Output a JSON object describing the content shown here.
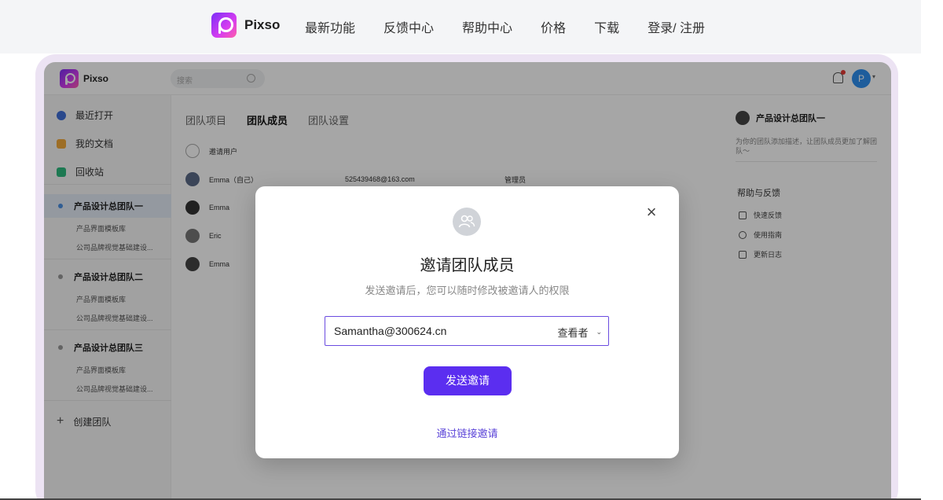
{
  "site": {
    "brand": "Pixso",
    "links": [
      "最新功能",
      "反馈中心",
      "帮助中心",
      "价格",
      "下载",
      "登录/ 注册"
    ]
  },
  "app": {
    "brand": "Pixso",
    "search_placeholder": "搜索",
    "avatar_letter": "P",
    "sidebar": {
      "recent": "最近打开",
      "docs": "我的文档",
      "trash": "回收站",
      "teams": [
        {
          "name": "产品设计总团队一",
          "subs": [
            "产品界面模板库",
            "公司品牌视觉基础建设..."
          ]
        },
        {
          "name": "产品设计总团队二",
          "subs": [
            "产品界面模板库",
            "公司品牌视觉基础建设..."
          ]
        },
        {
          "name": "产品设计总团队三",
          "subs": [
            "产品界面模板库",
            "公司品牌视觉基础建设..."
          ]
        }
      ],
      "create_team": "创建团队"
    },
    "tabs": [
      "团队项目",
      "团队成员",
      "团队设置"
    ],
    "members": [
      {
        "name": "邀请用户"
      },
      {
        "name": "Emma（自己）",
        "email": "525439468@163.com",
        "role": "管理员"
      },
      {
        "name": "Emma"
      },
      {
        "name": "Eric"
      },
      {
        "name": "Emma"
      }
    ],
    "right_panel": {
      "team_name": "产品设计总团队一",
      "description": "为你的团队添加描述，让团队成员更加了解团队～",
      "help_title": "帮助与反馈",
      "items": [
        "快速反馈",
        "使用指南",
        "更新日志"
      ]
    }
  },
  "modal": {
    "title": "邀请团队成员",
    "subtitle": "发送邀请后，您可以随时修改被邀请人的权限",
    "email_value": "Samantha@300624.cn",
    "role": "查看者",
    "send_label": "发送邀请",
    "link_invite": "通过链接邀请"
  }
}
